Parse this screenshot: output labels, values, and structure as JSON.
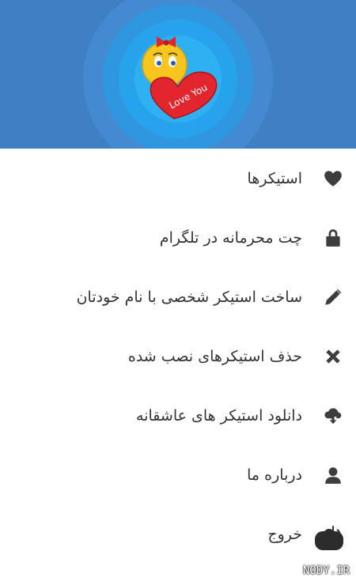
{
  "header": {
    "badge_text": "Love You",
    "colors": {
      "background": "#3f7fc4",
      "glow": "#2fb0f2"
    }
  },
  "menu": {
    "items": [
      {
        "label": "استیکرها",
        "icon": "heart-icon"
      },
      {
        "label": "چت محرمانه در تلگرام",
        "icon": "lock-icon"
      },
      {
        "label": "ساخت استیکر شخصی با نام خودتان",
        "icon": "pencil-icon"
      },
      {
        "label": "حذف استیکرهای نصب شده",
        "icon": "close-icon"
      },
      {
        "label": "دانلود استیکر های عاشقانه",
        "icon": "cloud-download-icon"
      },
      {
        "label": "درباره ما",
        "icon": "person-icon"
      },
      {
        "label": "خروج",
        "icon": "power-icon"
      }
    ]
  },
  "watermark": {
    "text": "NODY.IR"
  }
}
